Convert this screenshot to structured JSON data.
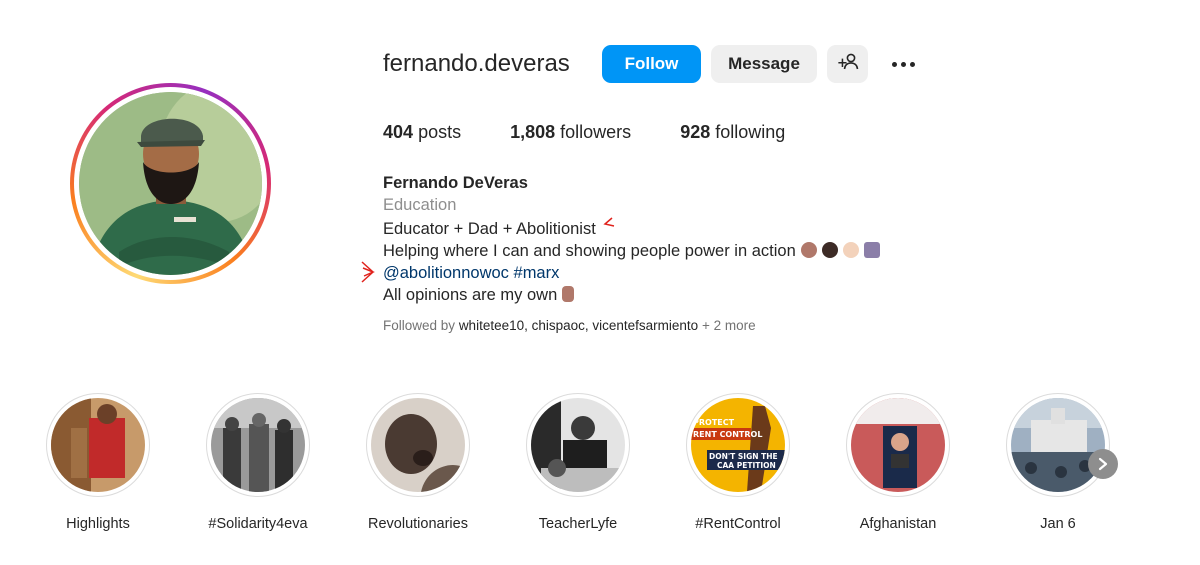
{
  "profile": {
    "username": "fernando.deveras",
    "follow_label": "Follow",
    "message_label": "Message",
    "add_user_label": "+",
    "stats": {
      "posts_count": "404",
      "posts_label": "posts",
      "followers_count": "1,808",
      "followers_label": "followers",
      "following_count": "928",
      "following_label": "following"
    },
    "bio": {
      "name": "Fernando DeVeras",
      "category": "Education",
      "line1": "Educator + Dad + Abolitionist",
      "line2": "Helping where I can and showing people power in action",
      "mention": "@abolitionnowoc",
      "hashtag": "#marx",
      "line4": "All opinions are my own"
    },
    "followed_by": {
      "prefix": "Followed by",
      "names": "whitetee10, chispaoc, vicentefsarmiento",
      "more": "+ 2 more"
    }
  },
  "highlights": [
    {
      "label": "Highlights"
    },
    {
      "label": "#Solidarity4eva"
    },
    {
      "label": "Revolutionaries"
    },
    {
      "label": "TeacherLyfe"
    },
    {
      "label": "#RentControl",
      "texts": [
        "PROTECT",
        "RENT CONTROL",
        "DON'T SIGN THE",
        "CAA PETITION"
      ]
    },
    {
      "label": "Afghanistan"
    },
    {
      "label": "Jan 6"
    }
  ],
  "icons": {
    "add_user": "add-user-icon",
    "more": "more-options-icon",
    "next": "chevron-right-icon"
  },
  "colors": {
    "follow_button": "#0095f6",
    "secondary_button": "#efefef",
    "link": "#00376b",
    "muted": "#8e8e8e"
  }
}
